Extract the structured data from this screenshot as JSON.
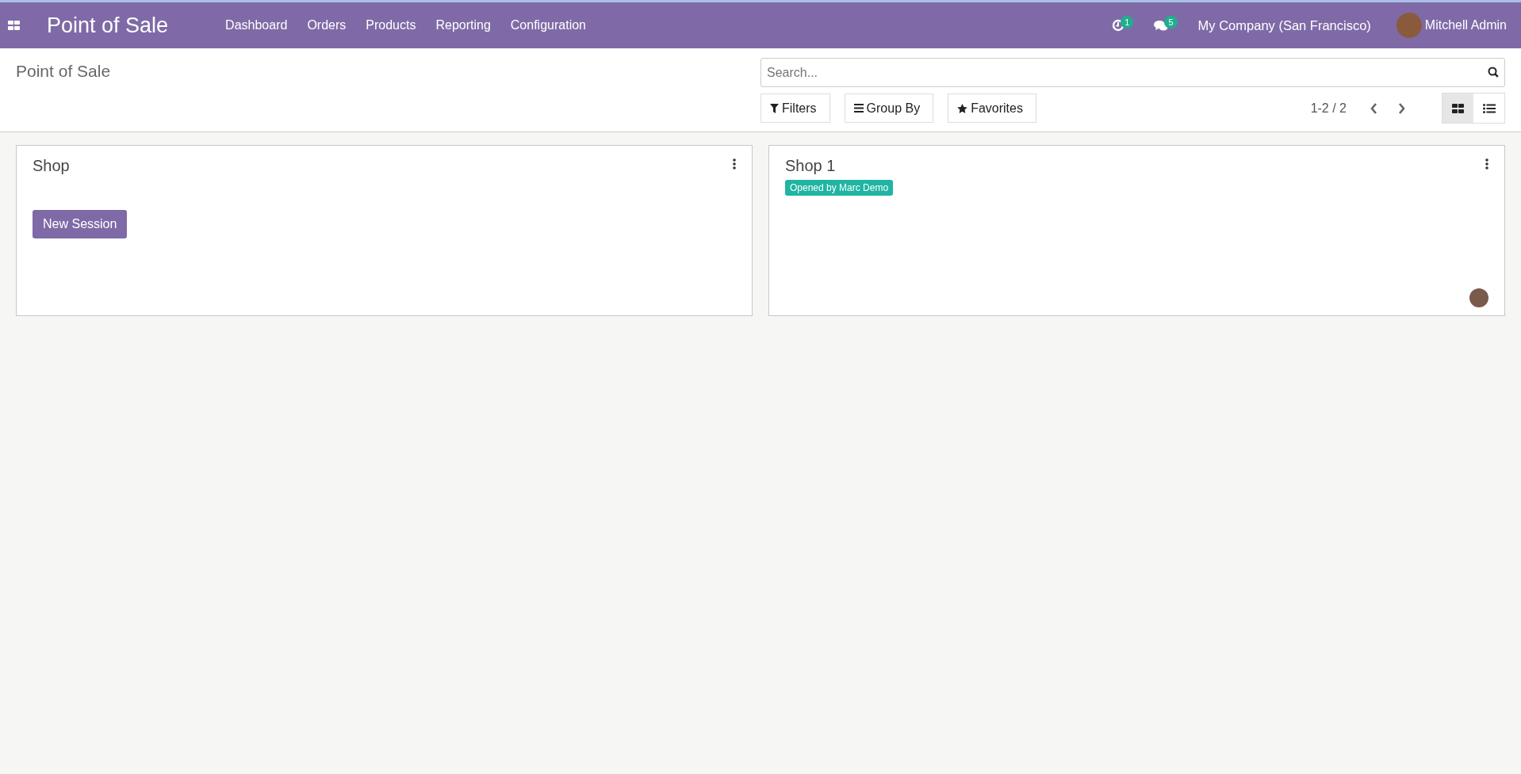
{
  "navbar": {
    "app_title": "Point of Sale",
    "menu": [
      "Dashboard",
      "Orders",
      "Products",
      "Reporting",
      "Configuration"
    ],
    "activity_count": "1",
    "message_count": "5",
    "company": "My Company (San Francisco)",
    "user": "Mitchell Admin"
  },
  "control_panel": {
    "breadcrumb": "Point of Sale",
    "search": {
      "placeholder": "Search..."
    },
    "filters": "Filters",
    "group_by": "Group By",
    "favorites": "Favorites",
    "pager": "1-2 / 2",
    "views": [
      {
        "kind": "kanban",
        "selected": true
      },
      {
        "kind": "list",
        "selected": false
      }
    ]
  },
  "cards": [
    {
      "name": "Shop",
      "kind": "new_session",
      "action": "New Session"
    },
    {
      "name": "Shop 1",
      "kind": "opened",
      "badge": "Opened by Marc Demo"
    }
  ]
}
